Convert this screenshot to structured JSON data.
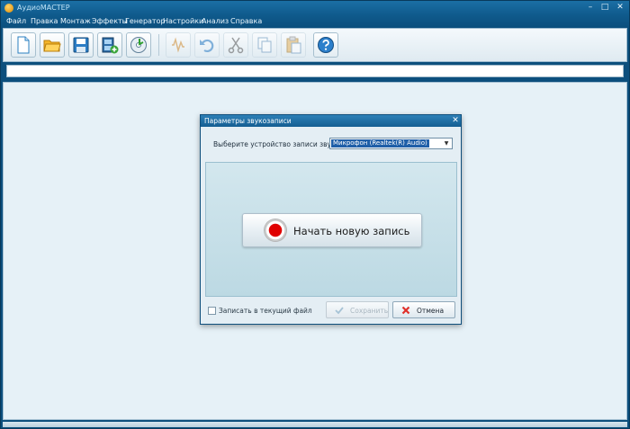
{
  "window": {
    "title": "АудиоМАСТЕР",
    "minimize": "–",
    "maximize": "□",
    "close": "✕"
  },
  "menu": [
    "Файл",
    "Правка",
    "Монтаж",
    "Эффекты",
    "Генератор",
    "Настройки",
    "Анализ",
    "Справка"
  ],
  "toolbar": {
    "buttons": [
      {
        "icon": "new-file-icon",
        "enabled": true
      },
      {
        "icon": "open-folder-icon",
        "enabled": true
      },
      {
        "icon": "save-disk-icon",
        "enabled": true
      },
      {
        "icon": "add-video-icon",
        "enabled": true
      },
      {
        "icon": "record-cd-icon",
        "enabled": true
      },
      {
        "icon": "sound-wave-icon",
        "enabled": false
      },
      {
        "icon": "undo-icon",
        "enabled": false
      },
      {
        "icon": "cut-icon",
        "enabled": false
      },
      {
        "icon": "copy-icon",
        "enabled": false
      },
      {
        "icon": "paste-icon",
        "enabled": false
      },
      {
        "icon": "help-icon",
        "enabled": true
      }
    ]
  },
  "dialog": {
    "title": "Параметры звукозаписи",
    "close": "✕",
    "device_label": "Выберите устройство записи звука:",
    "device_value": "Микрофон (Realtek(R) Audio)",
    "device_arrow": "▼",
    "start_record": "Начать новую запись",
    "record_to_current": "Записать в текущий файл",
    "record_to_current_checked": false,
    "save": "Сохранить",
    "save_enabled": false,
    "cancel": "Отмена"
  },
  "colors": {
    "accent": "#1f5fa8",
    "record": "#e00000",
    "titlebar": "#1b6fa5"
  }
}
